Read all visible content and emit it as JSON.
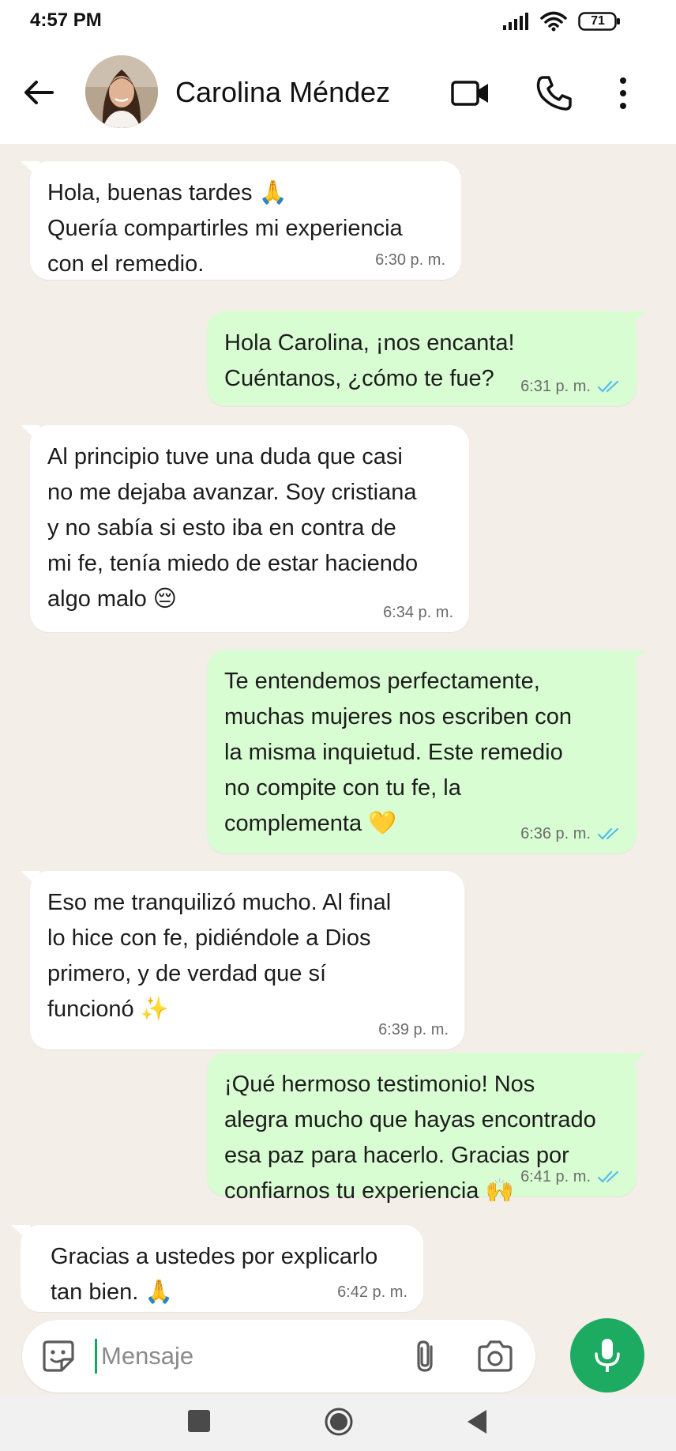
{
  "status_bar": {
    "time": "4:57 PM",
    "battery": "71",
    "icons": [
      "signal-icon",
      "wifi-icon",
      "battery-icon"
    ]
  },
  "header": {
    "contact_name": "Carolina Méndez",
    "icons": [
      "back-arrow-icon",
      "video-call-icon",
      "phone-icon",
      "more-options-icon"
    ]
  },
  "colors": {
    "incoming_bubble": "#ffffff",
    "outgoing_bubble": "#d9fdd3",
    "chat_background": "#f3efe8",
    "read_check": "#53bdeb",
    "accent_green": "#1daa61"
  },
  "messages": [
    {
      "direction": "in",
      "text": "Hola, buenas tardes 🙏\nQuería compartirles mi experiencia\ncon el remedio.",
      "time": "6:30 p. m."
    },
    {
      "direction": "out",
      "text": "Hola Carolina, ¡nos encanta!\nCuéntanos, ¿cómo te fue?",
      "time": "6:31 p. m.",
      "status": "read"
    },
    {
      "direction": "in",
      "text": "Al principio tuve una duda que casi\nno me dejaba avanzar. Soy cristiana\ny no sabía si esto iba en contra de\nmi fe, tenía miedo de estar haciendo\nalgo malo 😔",
      "time": "6:34 p. m."
    },
    {
      "direction": "out",
      "text": "Te entendemos perfectamente,\nmuchas mujeres nos escriben con\nla misma inquietud. Este remedio\nno compite con tu fe, la\ncomplementa 💛",
      "time": "6:36 p. m.",
      "status": "read"
    },
    {
      "direction": "in",
      "text": "Eso me tranquilizó mucho. Al final\nlo hice con fe, pidiéndole a Dios\nprimero, y de verdad que sí\nfuncionó ✨",
      "time": "6:39 p. m."
    },
    {
      "direction": "out",
      "text": "¡Qué hermoso testimonio! Nos\nalegra mucho que hayas encontrado\nesa paz para hacerlo. Gracias por\nconfiarnos tu experiencia 🙌",
      "time": "6:41 p. m.",
      "status": "read"
    },
    {
      "direction": "in",
      "text": "Gracias a ustedes por explicarlo\ntan bien. 🙏",
      "time": "6:42 p. m."
    }
  ],
  "composer": {
    "placeholder": "Mensaje",
    "icons": [
      "emoji-sticker-icon",
      "attach-paperclip-icon",
      "camera-icon",
      "microphone-icon"
    ]
  },
  "nav_bar": {
    "icons": [
      "recent-apps-icon",
      "home-icon",
      "back-icon"
    ]
  }
}
